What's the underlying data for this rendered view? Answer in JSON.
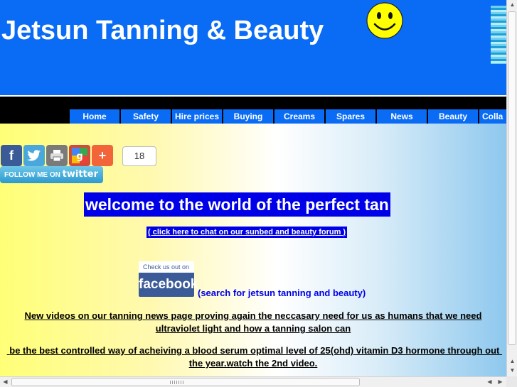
{
  "header": {
    "site_title": "Jetsun Tanning & Beauty",
    "smiley_icon": "smiley-face-icon",
    "background_color": "#0a6cf5"
  },
  "nav": {
    "items": [
      "Home",
      "Safety",
      "Hire prices",
      "Buying",
      "Creams",
      "Spares",
      "News",
      "Beauty",
      "Colla"
    ]
  },
  "social": {
    "icons": [
      "facebook-icon",
      "twitter-icon",
      "print-icon",
      "google-plus-icon",
      "add-share-icon"
    ],
    "share_count": "18",
    "follow_prefix": "FOLLOW ME ON ",
    "follow_brand": "twitter"
  },
  "main": {
    "welcome": "welcome to the world of the perfect tan",
    "forum_link": "( click here to chat on our sunbed and beauty forum )",
    "fb_badge_top": "Check us out on",
    "fb_badge_word": "facebook",
    "fb_search": "(search for jetsun tanning and beauty)",
    "news_1": "New videos on our tanning news page proving again the neccasary need for us as humans that we need ultraviolet light and how a tanning salon can",
    "news_2": " be the best controlled way of acheiving a blood serum optimal level of 25(ohd) vitamin D3 hormone through out the year.watch the 2nd video."
  },
  "colors": {
    "accent_blue": "#0000e8",
    "facebook_blue": "#3a5a98",
    "twitter_blue": "#2b9ad0"
  }
}
